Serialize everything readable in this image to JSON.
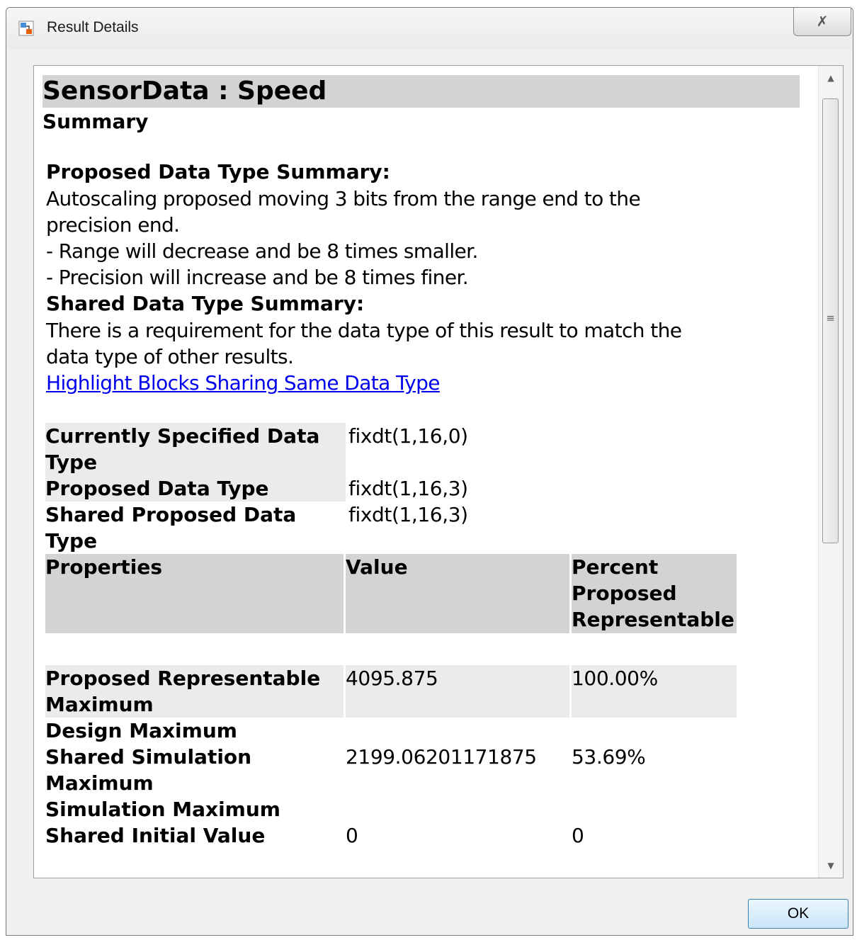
{
  "window": {
    "title": "Result Details",
    "close_glyph": "✗"
  },
  "document": {
    "heading": "SensorData : Speed",
    "subheading": "Summary",
    "proposed_summary": {
      "title": "Proposed Data Type Summary:",
      "line1": "Autoscaling proposed moving 3 bits from the range end to the precision end.",
      "line2": "- Range will decrease and be 8 times smaller.",
      "line3": "- Precision will increase and be 8 times finer."
    },
    "shared_summary": {
      "title": "Shared Data Type Summary:",
      "text": "There is a requirement for the data type of this result to match the data type of other results.",
      "link": "Highlight Blocks Sharing Same Data Type"
    },
    "types": [
      {
        "label": "Currently Specified Data Type",
        "value": "fixdt(1,16,0)"
      },
      {
        "label": "Proposed Data Type",
        "value": "fixdt(1,16,3)"
      },
      {
        "label": "Shared Proposed Data Type",
        "value": "fixdt(1,16,3)"
      }
    ],
    "properties": {
      "headers": [
        "Properties",
        "Value",
        "Percent Proposed Representable"
      ],
      "rows": [
        {
          "property": "Proposed Representable Maximum",
          "value": "4095.875",
          "percent": "100.00%"
        },
        {
          "property": "Design Maximum",
          "value": "",
          "percent": ""
        },
        {
          "property": "Shared Simulation Maximum",
          "value": "2199.06201171875",
          "percent": "53.69%"
        },
        {
          "property": "Simulation Maximum",
          "value": "",
          "percent": ""
        },
        {
          "property": "Shared Initial Value",
          "value": "0",
          "percent": "0"
        }
      ]
    }
  },
  "buttons": {
    "ok": "OK"
  },
  "scrollbar": {
    "up_arrow": "▲",
    "down_arrow": "▼",
    "grip": "≡"
  }
}
